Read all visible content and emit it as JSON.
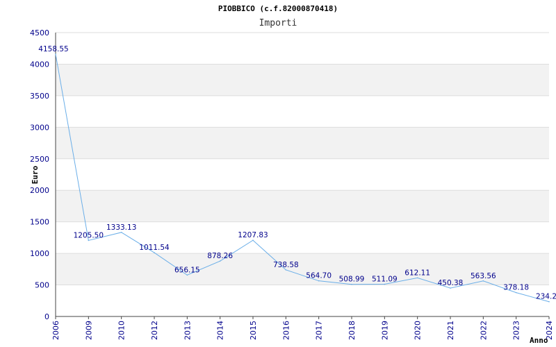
{
  "chart_data": {
    "type": "line",
    "title": "PIOBBICO (c.f.82000870418)",
    "subtitle": "Importi",
    "xlabel": "Anno",
    "ylabel": "Euro",
    "ylim": [
      0,
      4500
    ],
    "yticks": [
      "0",
      "500",
      "1000",
      "1500",
      "2000",
      "2500",
      "3000",
      "3500",
      "4000",
      "4500"
    ],
    "grid": "horizontal alternating bands",
    "categories": [
      "2006",
      "2009",
      "2010",
      "2012",
      "2013",
      "2014",
      "2015",
      "2016",
      "2017",
      "2018",
      "2019",
      "2020",
      "2021",
      "2022",
      "2023",
      "2024"
    ],
    "values": [
      4158.55,
      1205.5,
      1333.13,
      1011.54,
      656.15,
      878.26,
      1207.83,
      738.58,
      564.7,
      508.99,
      511.09,
      612.11,
      450.38,
      563.56,
      378.18,
      234.2
    ],
    "data_labels": [
      "4158.55",
      "1205.50",
      "1333.13",
      "1011.54",
      "656.15",
      "878.26",
      "1207.83",
      "738.58",
      "564.70",
      "508.99",
      "511.09",
      "612.11",
      "450.38",
      "563.56",
      "378.18",
      "234.2"
    ],
    "colors": {
      "line": "#6aaee8",
      "band": "#f2f2f2",
      "gridline": "#dddddd",
      "tick_text": "#00008b"
    }
  }
}
